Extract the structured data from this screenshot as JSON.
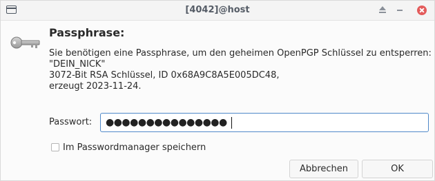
{
  "window": {
    "title": "[4042]@host"
  },
  "dialog": {
    "heading": "Passphrase:",
    "description_lines": [
      "Sie benötigen eine Passphrase, um den geheimen OpenPGP Schlüssel zu entsperren:",
      "\"DEIN_NICK\"",
      "3072-Bit RSA Schlüssel, ID 0x68A9C8A5E005DC48,",
      "erzeugt 2023-11-24."
    ],
    "password_label": "Passwort:",
    "password_masked": "●●●●●●●●●●●●●●●",
    "save_checkbox_label": "Im Passwordmanager speichern",
    "save_checkbox_checked": false
  },
  "buttons": {
    "cancel_label": "Abbrechen",
    "ok_label": "OK"
  },
  "colors": {
    "close_button": "#e35b5b",
    "focus_border": "#4f88c8"
  },
  "icons": {
    "app": "window-icon",
    "dialog": "key-icon"
  }
}
